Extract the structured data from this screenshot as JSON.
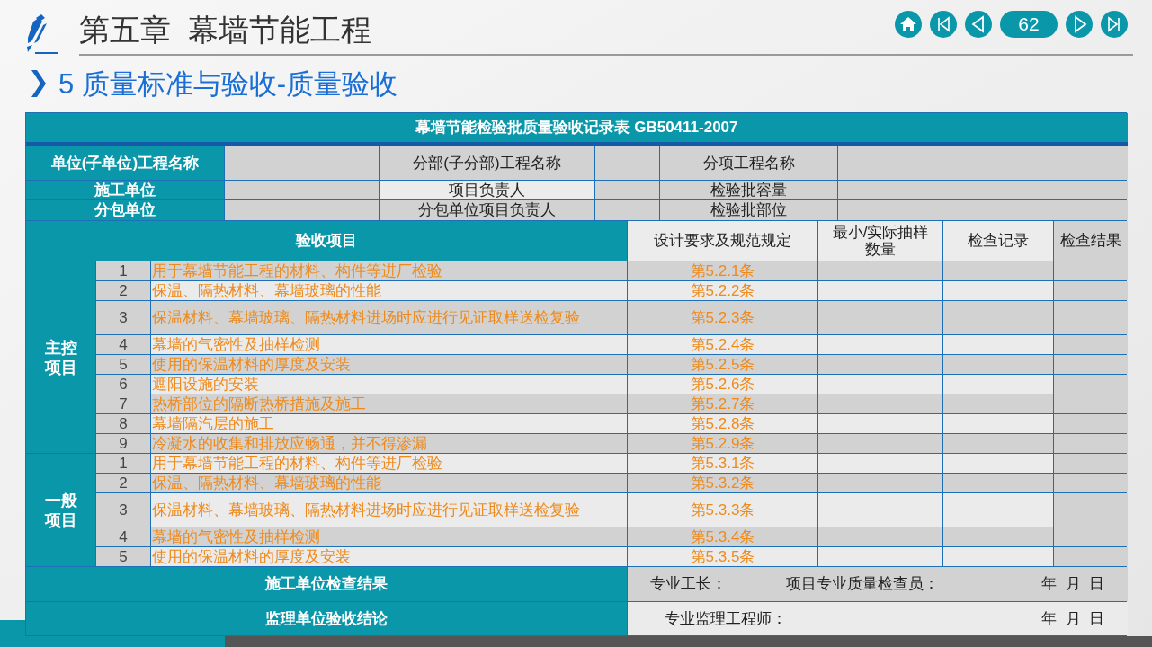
{
  "header": {
    "chapter_title": "第五章  幕墙节能工程",
    "section_number": "5",
    "section_title": "质量标准与验收-质量验收",
    "page_number": "62"
  },
  "nav_buttons": [
    {
      "kind": "home"
    },
    {
      "kind": "first"
    },
    {
      "kind": "prev"
    },
    {
      "kind": "page"
    },
    {
      "kind": "next"
    },
    {
      "kind": "last"
    }
  ],
  "table": {
    "title": "幕墙节能检验批质量验收记录表 GB50411-2007",
    "info_rows": [
      {
        "cells": [
          "单位(子单位)工程名称",
          "分部(子分部)工程名称",
          "分项工程名称"
        ]
      },
      {
        "cells": [
          "施工单位",
          "项目负责人",
          "检验批容量"
        ]
      },
      {
        "cells": [
          "分包单位",
          "分包单位项目负责人",
          "检验批部位"
        ]
      }
    ],
    "columns": [
      "验收项目",
      "设计要求及规范规定",
      "最小/实际抽样数量",
      "检查记录",
      "检查结果"
    ],
    "groups": [
      {
        "label": "主控项目",
        "items": [
          {
            "no": "1",
            "text": "用于幕墙节能工程的材料、构件等进厂检验",
            "spec": "第5.2.1条"
          },
          {
            "no": "2",
            "text": "保温、隔热材料、幕墙玻璃的性能",
            "spec": "第5.2.2条"
          },
          {
            "no": "3",
            "text": "保温材料、幕墙玻璃、隔热材料进场时应进行见证取样送检复验",
            "spec": "第5.2.3条"
          },
          {
            "no": "4",
            "text": "幕墙的气密性及抽样检测",
            "spec": "第5.2.4条"
          },
          {
            "no": "5",
            "text": "使用的保温材料的厚度及安装",
            "spec": "第5.2.5条"
          },
          {
            "no": "6",
            "text": "遮阳设施的安装",
            "spec": "第5.2.6条"
          },
          {
            "no": "7",
            "text": "热桥部位的隔断热桥措施及施工",
            "spec": "第5.2.7条"
          },
          {
            "no": "8",
            "text": "幕墙隔汽层的施工",
            "spec": "第5.2.8条"
          },
          {
            "no": "9",
            "text": "冷凝水的收集和排放应畅通，并不得渗漏",
            "spec": "第5.2.9条"
          }
        ]
      },
      {
        "label": "一般项目",
        "items": [
          {
            "no": "1",
            "text": "用于幕墙节能工程的材料、构件等进厂检验",
            "spec": "第5.3.1条"
          },
          {
            "no": "2",
            "text": "保温、隔热材料、幕墙玻璃的性能",
            "spec": "第5.3.2条"
          },
          {
            "no": "3",
            "text": "保温材料、幕墙玻璃、隔热材料进场时应进行见证取样送检复验",
            "spec": "第5.3.3条"
          },
          {
            "no": "4",
            "text": "幕墙的气密性及抽样检测",
            "spec": "第5.3.4条"
          },
          {
            "no": "5",
            "text": "使用的保温材料的厚度及安装",
            "spec": "第5.3.5条"
          }
        ]
      }
    ],
    "sign_rows": [
      {
        "label": "施工单位检查结果",
        "signers": [
          "专业工长：",
          "项目专业质量检查员："
        ],
        "date": "年  月  日"
      },
      {
        "label": "监理单位验收结论",
        "signers": [
          "专业监理工程师："
        ],
        "date": "年  月  日"
      }
    ]
  }
}
